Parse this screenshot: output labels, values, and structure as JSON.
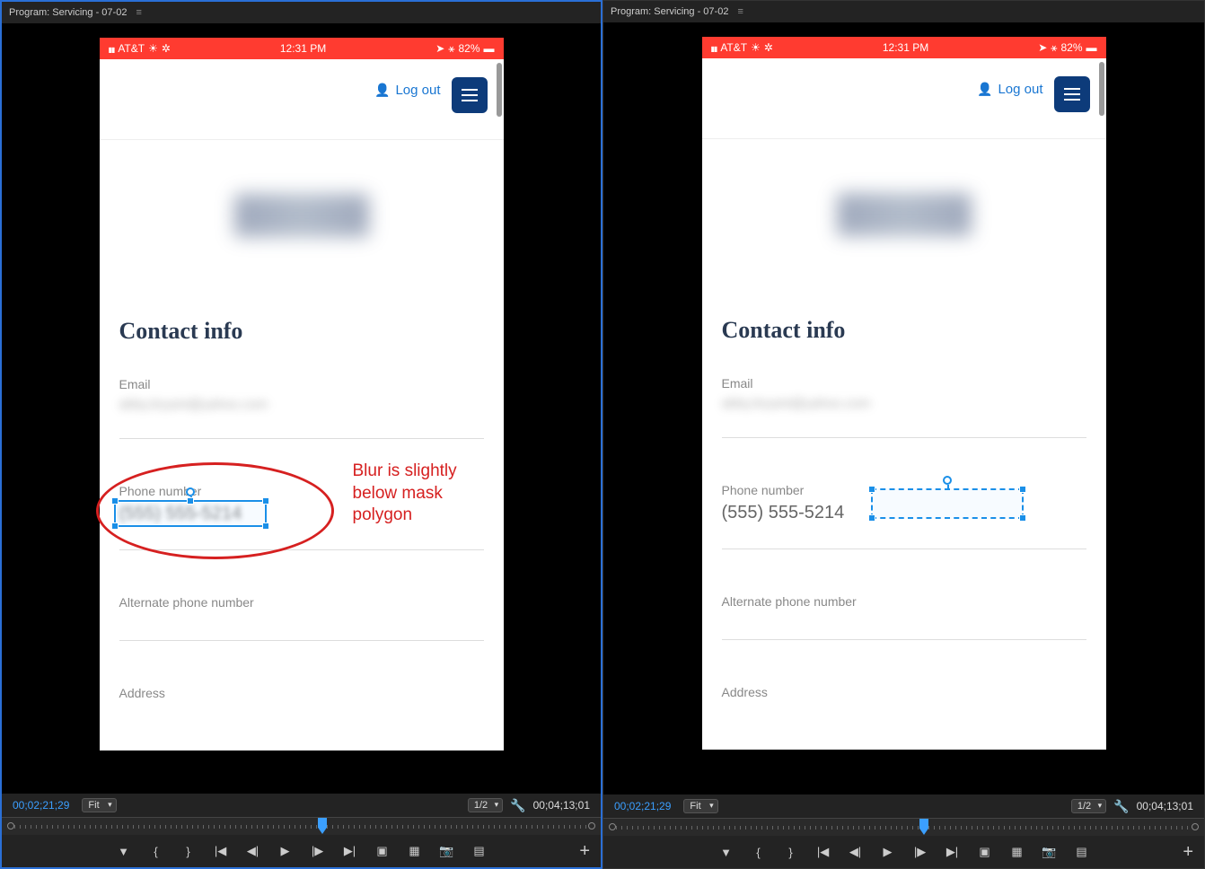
{
  "program_tab": "Program: Servicing - 07-02",
  "status_bar": {
    "carrier": "AT&T",
    "time": "12:31 PM",
    "battery": "82%"
  },
  "app": {
    "logout": "Log out",
    "section_title": "Contact info",
    "email_label": "Email",
    "email_blurred": "abby.bryant@yahoo.com",
    "phone_label": "Phone number",
    "phone_value": "(555) 555-5214",
    "alt_phone_label": "Alternate phone number",
    "address_label": "Address"
  },
  "annotation": {
    "line1": "Blur is slightly",
    "line2": "below mask",
    "line3": "polygon"
  },
  "controls": {
    "timecode_current": "00;02;21;29",
    "timecode_total": "00;04;13;01",
    "fit": "Fit",
    "ratio": "1/2"
  }
}
